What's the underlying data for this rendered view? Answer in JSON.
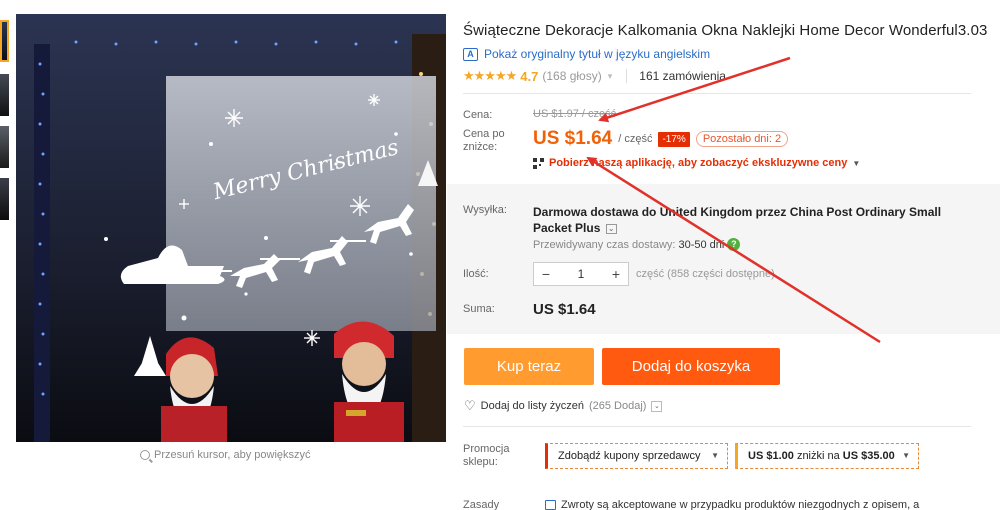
{
  "product": {
    "title": "Świąteczne Dekoracje Kalkomania Okna Naklejki Home Decor Wonderful3.03",
    "original_title_link": "Pokaż oryginalny tytuł w języku angielskim",
    "rating_stars": "★★★★★",
    "rating_value": "4.7",
    "rating_count": "(168 głosy)",
    "orders": "161 zamówienia"
  },
  "price": {
    "label_price": "Cena:",
    "old_price": "US $1.97 / część",
    "label_discount_price": "Cena po zniżce:",
    "current_price": "US $1.64",
    "per_piece": "/ część",
    "discount": "-17%",
    "time_left": "Pozostało dni: 2",
    "app_promo": "Pobierz naszą aplikację, aby zobaczyć ekskluzywne ceny"
  },
  "shipping": {
    "label": "Wysyłka:",
    "text": "Darmowa dostawa do United Kingdom przez China Post Ordinary Small Packet Plus",
    "eta_label": "Przewidywany czas dostawy:",
    "eta_value": "30-50 dni"
  },
  "quantity": {
    "label": "Ilość:",
    "minus": "−",
    "value": "1",
    "plus": "+",
    "stock": "część (858 części dostępne)"
  },
  "total": {
    "label": "Suma:",
    "value": "US $1.64"
  },
  "actions": {
    "buy_now": "Kup teraz",
    "add_to_cart": "Dodaj do koszyka",
    "wishlist": "Dodaj do listy życzeń",
    "wishlist_count": "(265 Dodaj)"
  },
  "promotions": {
    "label": "Promocja sklepu:",
    "coupon_seller": "Zdobądź kupony sprzedawcy",
    "coupon_amount": "US $1.00",
    "coupon_mid": "zniżki na",
    "coupon_threshold": "US $35.00"
  },
  "policy": {
    "label": "Zasady",
    "text": "Zwroty są akceptowane w przypadku produktów niezgodnych z opisem, a"
  },
  "gallery": {
    "zoom_hint": "Przesuń kursor, aby powiększyć",
    "image_text": "Merry Christmas"
  },
  "colors": {
    "accent_orange": "#ff5a0f",
    "buy_orange": "#ff9b2f",
    "price_orange": "#f0620a",
    "annotation_red": "#e0312b",
    "star_gold": "#f5a623"
  }
}
